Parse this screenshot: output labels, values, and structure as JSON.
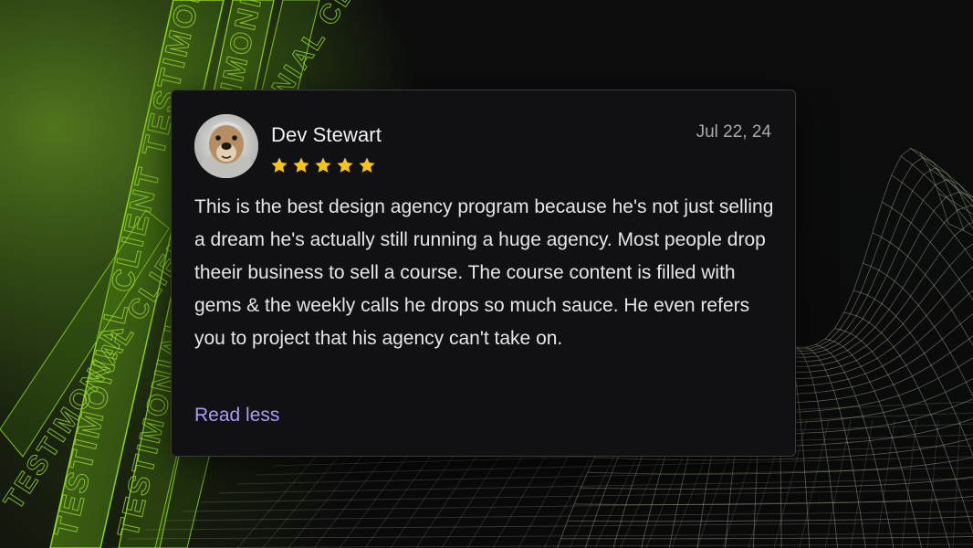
{
  "background": {
    "ribbon_text": "TESTIMONIAL CLIENT TESTIMONIAL CLIENT TESTIMONIAL CLIENT"
  },
  "review": {
    "author": "Dev Stewart",
    "date": "Jul 22, 24",
    "rating": 5,
    "max_rating": 5,
    "body": "This is the best design agency program because he's not just selling a dream he's actually still running a huge agency. Most people drop theeir business to sell a course. The course content is filled with gems & the weekly calls he drops so much sauce. He even refers you to project that his agency can't take on.",
    "toggle_label": "Read less"
  },
  "colors": {
    "star": "#f5c518",
    "link": "#a99cf2",
    "accent_green": "#9ad934"
  }
}
